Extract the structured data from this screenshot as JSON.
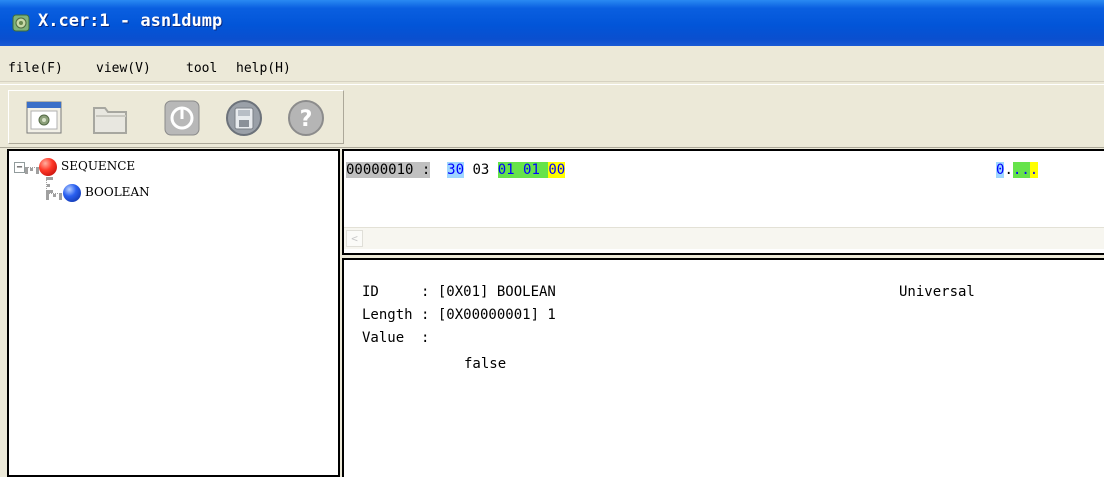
{
  "window": {
    "title": "X.cer:1 - asn1dump"
  },
  "menu": [
    {
      "label": "file(F)"
    },
    {
      "label": "view(V)"
    },
    {
      "label": "tool"
    },
    {
      "label": "help(H)"
    }
  ],
  "toolbar": {
    "buttons": [
      {
        "name": "open-window-icon"
      },
      {
        "name": "folder-icon"
      },
      {
        "name": "power-icon"
      },
      {
        "name": "save-disk-icon"
      },
      {
        "name": "help-question-icon"
      }
    ]
  },
  "tree": {
    "expander": "−",
    "nodes": [
      {
        "label": "SEQUENCE",
        "icon": "red-ball-icon",
        "color": "#e02020"
      },
      {
        "label": "BOOLEAN",
        "icon": "blue-ball-icon",
        "color": "#1a4fd8"
      }
    ]
  },
  "hex": {
    "address": "00000010 :",
    "bytes": [
      "30",
      "03",
      "01",
      "01",
      "00"
    ],
    "ascii": [
      "0",
      ".",
      ".",
      ".",
      "."
    ]
  },
  "details": {
    "id_line": "ID     : [0X01] BOOLEAN",
    "class": "Universal",
    "length_line": "Length : [0X00000001] 1",
    "value_line": "Value  :",
    "value": "false"
  },
  "colors": {
    "titlebar": "#0a55d8",
    "hl_blue": "#9fd6ff",
    "hl_green": "#66e34a",
    "hl_yellow": "#ffff00"
  }
}
